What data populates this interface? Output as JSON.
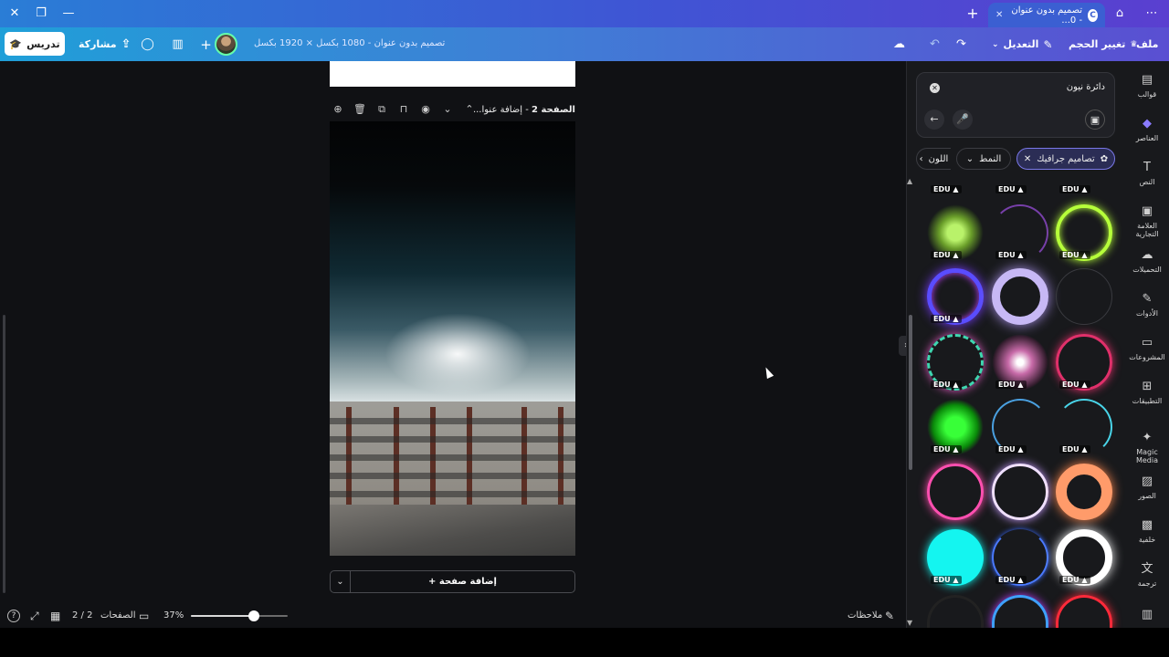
{
  "window": {
    "tab_title": "تصميم بدون عنوان - 0..."
  },
  "toolbar": {
    "file": "ملف",
    "resize": "تغيير الحجم",
    "edit": "التعديل",
    "doc_title": "تصميم بدون عنوان - 1080 بكسل × 1920 بكسل",
    "share": "مشاركة",
    "teach": "تدريس"
  },
  "canvas": {
    "page_label_bold": "الصفحة 2",
    "page_label_rest": " - إضافة عنوا...",
    "add_page": "+ إضافة صفحة"
  },
  "bottom": {
    "notes": "ملاحظات",
    "zoom": "37%",
    "zoom_level": 0.65,
    "pages": "الصفحات",
    "page_count": "2 / 2"
  },
  "search": {
    "query": "دائرة نيون"
  },
  "filters": {
    "graphics": "تصاميم جرافيك",
    "style": "النمط",
    "color": "اللون"
  },
  "badge": "EDU",
  "rail": [
    {
      "label": "قوالب",
      "icon": "templates-icon"
    },
    {
      "label": "العناصر",
      "icon": "elements-icon"
    },
    {
      "label": "النص",
      "icon": "text-icon"
    },
    {
      "label": "العلامة التجارية",
      "icon": "brand-icon"
    },
    {
      "label": "التحميلات",
      "icon": "uploads-icon"
    },
    {
      "label": "الأدوات",
      "icon": "tools-icon"
    },
    {
      "label": "المشروعات",
      "icon": "projects-icon"
    },
    {
      "label": "التطبيقات",
      "icon": "apps-icon"
    },
    {
      "label": "Magic Media",
      "icon": "magic-media-icon"
    },
    {
      "label": "الصور",
      "icon": "photos-icon"
    },
    {
      "label": "خلفية",
      "icon": "background-icon"
    },
    {
      "label": "ترجمة",
      "icon": "translate-icon"
    }
  ]
}
